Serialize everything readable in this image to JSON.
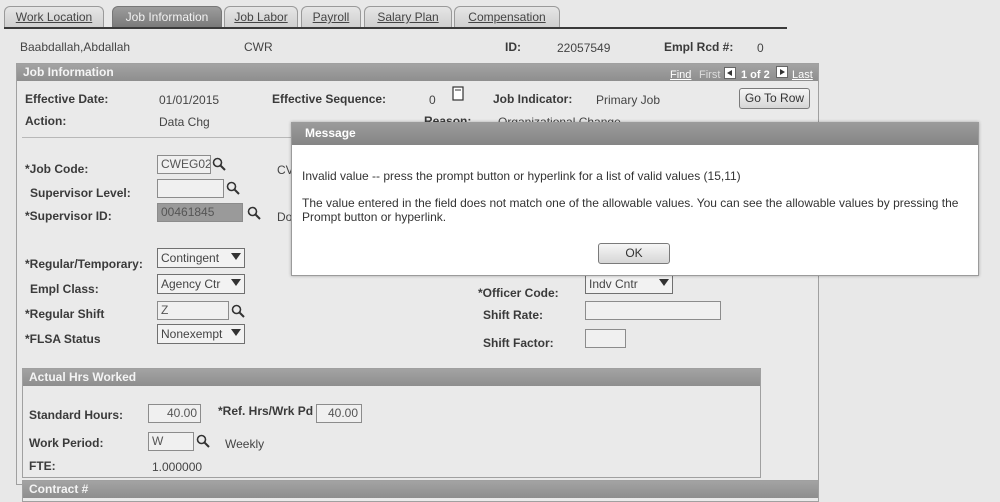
{
  "tabs": [
    "Work Location",
    "Job Information",
    "Job Labor",
    "Payroll",
    "Salary Plan",
    "Compensation"
  ],
  "header": {
    "name": "Baabdallah,Abdallah",
    "type": "CWR",
    "id_label": "ID:",
    "id_value": "22057549",
    "empl_rcd_label": "Empl Rcd #:",
    "empl_rcd_value": "0"
  },
  "job_panel": {
    "title": "Job Information",
    "find": "Find",
    "first": "First",
    "count": "1 of 2",
    "last": "Last",
    "effective_date_label": "Effective Date:",
    "effective_date": "01/01/2015",
    "effective_seq_label": "Effective Sequence:",
    "effective_seq": "0",
    "job_indicator_label": "Job Indicator:",
    "job_indicator": "Primary Job",
    "go_to_row": "Go To Row",
    "action_label": "Action:",
    "action": "Data Chg",
    "reason_label": "Reason:",
    "reason": "Organizational Change",
    "job_code_label": "*Job Code:",
    "job_code": "CWEG02",
    "job_code_desc": "CV",
    "supervisor_level_label": "Supervisor Level:",
    "supervisor_level": "",
    "supervisor_id_label": "*Supervisor ID:",
    "supervisor_id": "00461845",
    "supervisor_desc": "Do",
    "reg_temp_label": "*Regular/Temporary:",
    "reg_temp": "Contingent",
    "empl_class_label": "Empl Class:",
    "empl_class": "Agency Ctr",
    "regular_shift_label": "*Regular Shift",
    "regular_shift": "Z",
    "flsa_label": "*FLSA Status",
    "flsa": "Nonexempt",
    "officer_code_label": "*Officer Code:",
    "officer_code": "Indv Cntr",
    "shift_rate_label": "Shift Rate:",
    "shift_rate": "",
    "shift_factor_label": "Shift Factor:",
    "shift_factor": ""
  },
  "hours_panel": {
    "title": "Actual Hrs Worked",
    "standard_hours_label": "Standard Hours:",
    "standard_hours": "40.00",
    "ref_hrs_label": "*Ref. Hrs/Wrk Pd",
    "ref_hrs": "40.00",
    "work_period_label": "Work Period:",
    "work_period": "W",
    "work_period_desc": "Weekly",
    "fte_label": "FTE:",
    "fte": "1.000000"
  },
  "contract_panel": {
    "title": "Contract #"
  },
  "modal": {
    "title": "Message",
    "line1": "Invalid value -- press the prompt button or hyperlink for a list of valid values (15,11)",
    "line2a": "The value entered in the field does not match one of the allowable values.  You can see the allowable values by pressing the",
    "line2b": "Prompt button or hyperlink.",
    "ok": "OK"
  },
  "icons": [
    "search-icon",
    "calendar-icon",
    "nav-prev-icon",
    "nav-next-icon",
    "dropdown-arrow-icon"
  ]
}
